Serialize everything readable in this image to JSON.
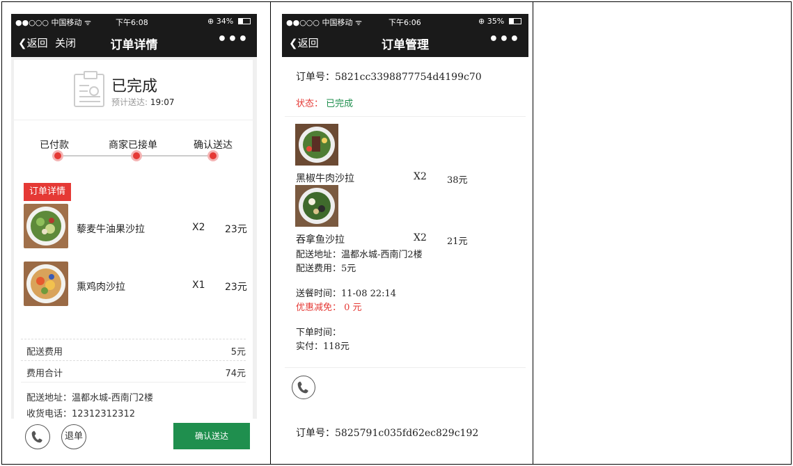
{
  "phone1": {
    "status_bar": {
      "carrier": "●●○○○ 中国移动 ᯤ",
      "time": "下午6:08",
      "battery": "⊕ 34%"
    },
    "nav": {
      "back": "❮返回",
      "close": "关闭",
      "title": "订单详情",
      "more": "•••"
    },
    "order_status": {
      "title": "已完成",
      "eta_label": "预计送达:",
      "eta_time": "19:07"
    },
    "steps": [
      "已付款",
      "商家已接单",
      "确认送达"
    ],
    "detail_tag": "订单详情",
    "items": [
      {
        "name": "藜麦牛油果沙拉",
        "qty": "X2",
        "price": "23元"
      },
      {
        "name": "熏鸡肉沙拉",
        "qty": "X1",
        "price": "23元"
      }
    ],
    "fees": [
      {
        "label": "配送费用",
        "value": "5元"
      },
      {
        "label": "费用合计",
        "value": "74元"
      }
    ],
    "address": "配送地址：温都水城-西南门2楼",
    "phone": "收货电话：12312312312",
    "buttons": {
      "call_icon": "phone-icon",
      "refund": "退单",
      "confirm": "确认送达"
    }
  },
  "phone2": {
    "status_bar": {
      "carrier": "●●○○○ 中国移动 ᯤ",
      "time": "下午6:06",
      "battery": "⊕ 35%"
    },
    "nav": {
      "back": "❮返回",
      "title": "订单管理",
      "more": "•••"
    },
    "order1": {
      "order_no": "订单号：5821cc3398877754d4199c70",
      "status_label": "状态：",
      "status_value": "已完成",
      "items": [
        {
          "name": "黑椒牛肉沙拉",
          "qty": "X2",
          "price": "38元"
        },
        {
          "name": "吞拿鱼沙拉",
          "qty": "X2",
          "price": "21元"
        }
      ],
      "address": "配送地址：温都水城-西南门2楼",
      "delivery_fee": "配送费用：5元",
      "delivery_time": "送餐时间：11-08 22:14",
      "discount": "优惠减免： 0 元",
      "order_time": "下单时间：",
      "paid": "实付：118元"
    },
    "order2": {
      "order_no": "订单号：5825791c035fd62ec829c192"
    }
  },
  "colors": {
    "accent_red": "#e53935",
    "green": "#1f8f4e",
    "nav_bg": "#1a1a1a"
  }
}
